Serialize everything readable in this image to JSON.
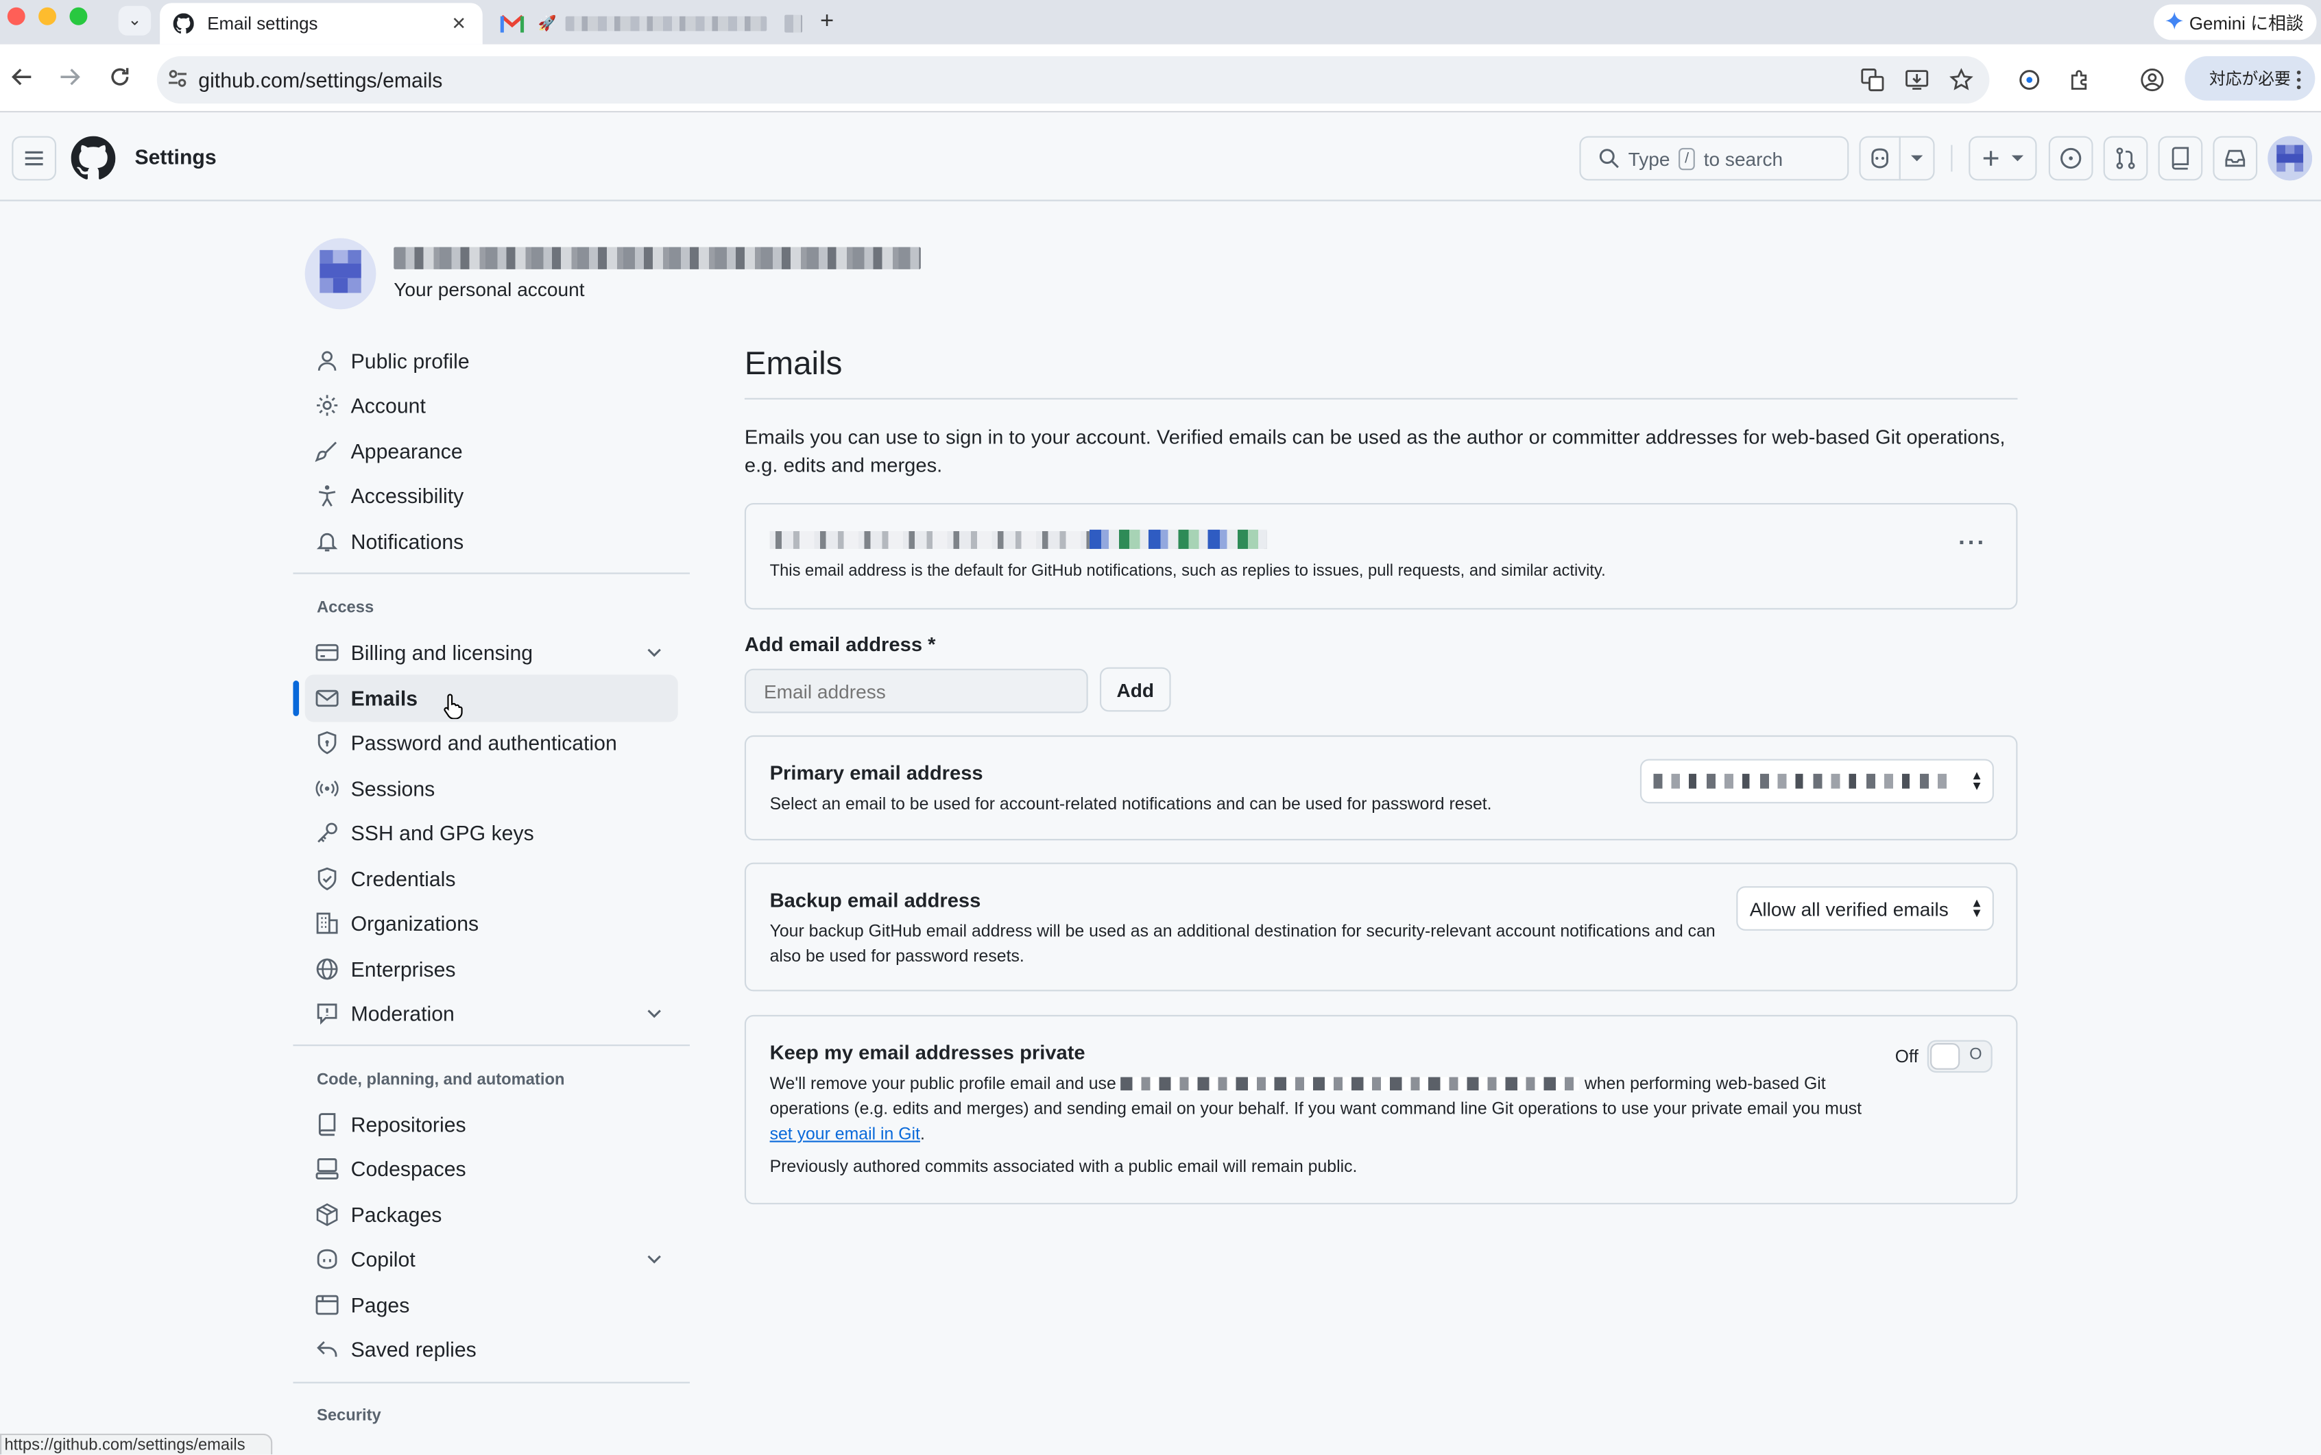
{
  "browser": {
    "active_tab_title": "Email settings",
    "close_glyph": "✕",
    "new_tab_glyph": "+",
    "tab_dropdown_glyph": "⌄",
    "url": "github.com/settings/emails",
    "gemini_label": "Gemini に相談",
    "action_label": "対応が必要",
    "status_url": "https://github.com/settings/emails",
    "traffic_colors": [
      "#ff5f57",
      "#febc2e",
      "#28c840"
    ]
  },
  "header": {
    "title": "Settings",
    "search_prefix": "Type",
    "search_key": "/",
    "search_suffix": "to search"
  },
  "profile": {
    "subtitle": "Your personal account"
  },
  "sidebar": {
    "items_top": [
      {
        "label": "Public profile",
        "icon": "person-icon"
      },
      {
        "label": "Account",
        "icon": "gear-icon"
      },
      {
        "label": "Appearance",
        "icon": "paintbrush-icon"
      },
      {
        "label": "Accessibility",
        "icon": "accessibility-icon"
      },
      {
        "label": "Notifications",
        "icon": "bell-icon"
      }
    ],
    "access_header": "Access",
    "items_access": [
      {
        "label": "Billing and licensing",
        "icon": "credit-card-icon",
        "expandable": true
      },
      {
        "label": "Emails",
        "icon": "mail-icon",
        "selected": true
      },
      {
        "label": "Password and authentication",
        "icon": "shield-lock-icon"
      },
      {
        "label": "Sessions",
        "icon": "broadcast-icon"
      },
      {
        "label": "SSH and GPG keys",
        "icon": "key-icon"
      },
      {
        "label": "Credentials",
        "icon": "shield-check-icon"
      },
      {
        "label": "Organizations",
        "icon": "organization-icon"
      },
      {
        "label": "Enterprises",
        "icon": "globe-icon"
      },
      {
        "label": "Moderation",
        "icon": "report-icon",
        "expandable": true
      }
    ],
    "code_header": "Code, planning, and automation",
    "items_code": [
      {
        "label": "Repositories",
        "icon": "repo-icon"
      },
      {
        "label": "Codespaces",
        "icon": "codespaces-icon"
      },
      {
        "label": "Packages",
        "icon": "package-icon"
      },
      {
        "label": "Copilot",
        "icon": "copilot-icon",
        "expandable": true
      },
      {
        "label": "Pages",
        "icon": "browser-icon"
      },
      {
        "label": "Saved replies",
        "icon": "reply-icon"
      }
    ],
    "security_header": "Security"
  },
  "main": {
    "title": "Emails",
    "intro": "Emails you can use to sign in to your account. Verified emails can be used as the author or committer addresses for web-based Git operations, e.g. edits and merges.",
    "default_email_note": "This email address is the default for GitHub notifications, such as replies to issues, pull requests, and similar activity.",
    "more_glyph": "···",
    "add_label": "Add email address *",
    "add_placeholder": "Email address",
    "add_button": "Add",
    "primary_title": "Primary email address",
    "primary_desc": "Select an email to be used for account-related notifications and can be used for password reset.",
    "backup_title": "Backup email address",
    "backup_desc": "Your backup GitHub email address will be used as an additional destination for security-relevant account notifications and can also be used for password resets.",
    "backup_select": "Allow all verified emails",
    "private_title": "Keep my email addresses private",
    "private_desc_1": "We'll remove your public profile email and use",
    "private_desc_2": "when performing web-based Git operations (e.g. edits and merges) and sending email on your behalf. If you want command line Git operations to use your private email you must",
    "private_link": "set your email in Git",
    "private_desc_3": ".",
    "private_note": "Previously authored commits associated with a public email will remain public.",
    "toggle_label": "Off",
    "toggle_state_glyph": "O"
  }
}
